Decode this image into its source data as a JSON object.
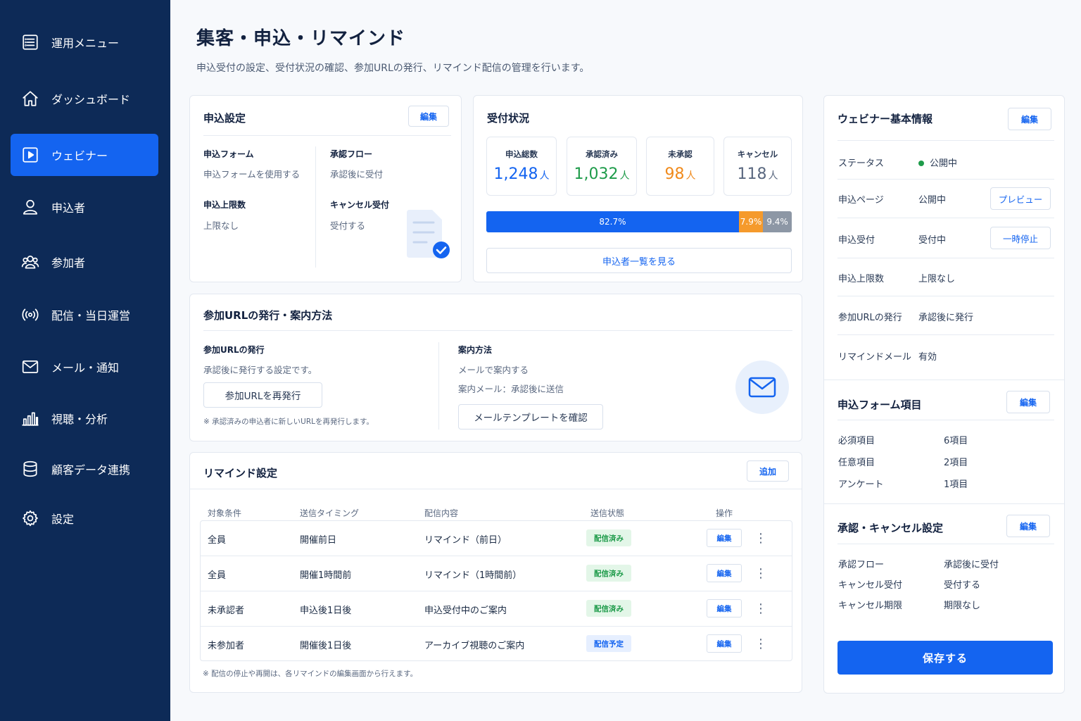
{
  "sidebar": {
    "items": [
      {
        "label": "運用メニュー",
        "icon": "menu-list-icon"
      },
      {
        "label": "ダッシュボード",
        "icon": "home-icon"
      },
      {
        "label": "ウェビナー",
        "icon": "play-icon",
        "active": true
      },
      {
        "label": "申込者",
        "icon": "user-icon"
      },
      {
        "label": "参加者",
        "icon": "users-icon"
      },
      {
        "label": "配信・当日運営",
        "icon": "broadcast-icon"
      },
      {
        "label": "メール・通知",
        "icon": "mail-icon"
      },
      {
        "label": "視聴・分析",
        "icon": "bar-chart-icon"
      },
      {
        "label": "顧客データ連携",
        "icon": "database-icon"
      },
      {
        "label": "設定",
        "icon": "gear-icon"
      }
    ]
  },
  "header": {
    "title": "集客・申込・リマインド",
    "description": "申込受付の設定、受付状況の確認、参加URLの発行、リマインド配信の管理を行います。"
  },
  "application_settings": {
    "title": "申込設定",
    "edit_label": "編集",
    "form_label": "申込フォーム",
    "form_value": "申込フォームを使用する",
    "limit_label": "申込上限数",
    "limit_value": "上限なし",
    "flow_label": "承認フロー",
    "flow_value": "承認後に受付",
    "cancel_label": "キャンセル受付",
    "cancel_value": "受付する"
  },
  "reception_status": {
    "title": "受付状況",
    "stats": [
      {
        "label": "申込総数",
        "value": "1,248",
        "unit": "人",
        "color": "#1464f0"
      },
      {
        "label": "承認済み",
        "value": "1,032",
        "unit": "人",
        "color": "#1e9b4a"
      },
      {
        "label": "未承認",
        "value": "98",
        "unit": "人",
        "color": "#f08a1c"
      },
      {
        "label": "キャンセル",
        "value": "118",
        "unit": "人",
        "color": "#5a6880"
      }
    ],
    "progress": [
      {
        "label": "82.7%",
        "percent": 82.7,
        "color": "#1464f0"
      },
      {
        "label": "7.9%",
        "percent": 7.9,
        "color": "#f59a2c"
      },
      {
        "label": "9.4%",
        "percent": 9.4,
        "color": "#8d97a5"
      }
    ],
    "list_button": "申込者一覧を見る"
  },
  "url_issue": {
    "title": "参加URLの発行・案内方法",
    "issue_label": "参加URLの発行",
    "issue_desc": "承認後に発行する設定です。",
    "reissue_button": "参加URLを再発行",
    "reissue_note": "※ 承認済みの申込者に新しいURLを再発行します。",
    "guide_label": "案内方法",
    "guide_method": "メールで案内する",
    "guide_mail": "案内メール：承認後に送信",
    "template_button": "メールテンプレートを確認"
  },
  "reminder": {
    "title": "リマインド設定",
    "add_label": "追加",
    "columns": [
      "対象条件",
      "送信タイミング",
      "配信内容",
      "送信状態",
      "操作"
    ],
    "rows": [
      {
        "target": "全員",
        "timing": "開催前日",
        "content": "リマインド（前日）",
        "status": "配信済み",
        "status_type": "sent",
        "edit": "編集"
      },
      {
        "target": "全員",
        "timing": "開催1時間前",
        "content": "リマインド（1時間前）",
        "status": "配信済み",
        "status_type": "sent",
        "edit": "編集"
      },
      {
        "target": "未承認者",
        "timing": "申込後1日後",
        "content": "申込受付中のご案内",
        "status": "配信済み",
        "status_type": "sent",
        "edit": "編集"
      },
      {
        "target": "未参加者",
        "timing": "開催後1日後",
        "content": "アーカイブ視聴のご案内",
        "status": "配信予定",
        "status_type": "plan",
        "edit": "編集"
      }
    ],
    "note": "※ 配信の停止や再開は、各リマインドの編集画面から行えます。"
  },
  "webinar_info": {
    "title": "ウェビナー基本情報",
    "edit_label": "編集",
    "status_label": "ステータス",
    "status_value": "公開中",
    "page_label": "申込ページ",
    "page_value": "公開中",
    "page_button": "プレビュー",
    "accept_label": "申込受付",
    "accept_value": "受付中",
    "accept_button": "一時停止",
    "limit_label": "申込上限数",
    "limit_value": "上限なし",
    "url_label": "参加URLの発行",
    "url_value": "承認後に発行",
    "remind_label": "リマインドメール",
    "remind_value": "有効"
  },
  "form_items": {
    "title": "申込フォーム項目",
    "edit_label": "編集",
    "required_label": "必須項目",
    "required_value": "6項目",
    "optional_label": "任意項目",
    "optional_value": "2項目",
    "survey_label": "アンケート",
    "survey_value": "1項目"
  },
  "approval_settings": {
    "title": "承認・キャンセル設定",
    "edit_label": "編集",
    "flow_label": "承認フロー",
    "flow_value": "承認後に受付",
    "cancel_label": "キャンセル受付",
    "cancel_value": "受付する",
    "deadline_label": "キャンセル期限",
    "deadline_value": "期限なし"
  },
  "save_label": "保存する"
}
